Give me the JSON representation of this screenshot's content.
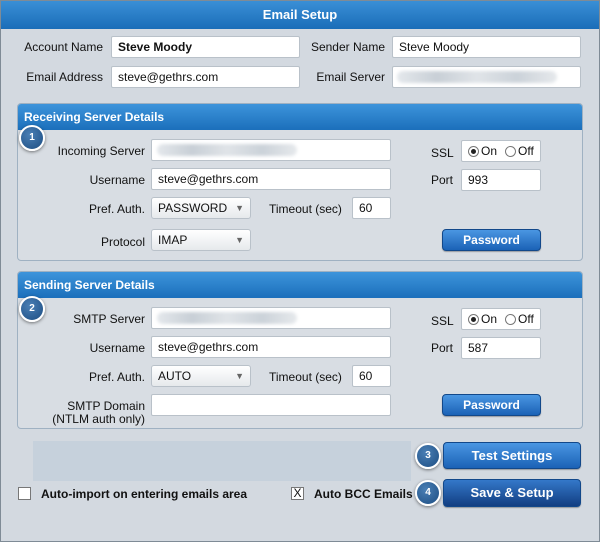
{
  "window": {
    "title": "Email Setup"
  },
  "account": {
    "account_name_label": "Account Name",
    "account_name_value": "Steve Moody",
    "sender_name_label": "Sender Name",
    "sender_name_value": "Steve Moody",
    "email_address_label": "Email Address",
    "email_address_value": "steve@gethrs.com",
    "email_server_label": "Email Server",
    "email_server_value": ""
  },
  "receiving": {
    "header": "Receiving Server Details",
    "badge": "1",
    "incoming_server_label": "Incoming Server",
    "incoming_server_value": "",
    "username_label": "Username",
    "username_value": "steve@gethrs.com",
    "pref_auth_label": "Pref. Auth.",
    "pref_auth_value": "PASSWORD",
    "timeout_label": "Timeout (sec)",
    "timeout_value": "60",
    "protocol_label": "Protocol",
    "protocol_value": "IMAP",
    "ssl_label": "SSL",
    "ssl_on_label": "On",
    "ssl_off_label": "Off",
    "ssl_selected": "On",
    "port_label": "Port",
    "port_value": "993",
    "password_button": "Password"
  },
  "sending": {
    "header": "Sending Server Details",
    "badge": "2",
    "smtp_server_label": "SMTP Server",
    "smtp_server_value": "",
    "username_label": "Username",
    "username_value": "steve@gethrs.com",
    "pref_auth_label": "Pref. Auth.",
    "pref_auth_value": "AUTO",
    "timeout_label": "Timeout (sec)",
    "timeout_value": "60",
    "smtp_domain_label": "SMTP Domain",
    "smtp_domain_sub_label": "(NTLM auth only)",
    "smtp_domain_value": "",
    "ssl_label": "SSL",
    "ssl_on_label": "On",
    "ssl_off_label": "Off",
    "ssl_selected": "On",
    "port_label": "Port",
    "port_value": "587",
    "password_button": "Password"
  },
  "footer": {
    "test_badge": "3",
    "test_button": "Test Settings",
    "save_badge": "4",
    "save_button": "Save & Setup",
    "auto_import_label": "Auto-import on entering emails area",
    "auto_import_checked": false,
    "auto_bcc_label": "Auto BCC Emails",
    "auto_bcc_checked": true,
    "auto_bcc_mark": "X"
  },
  "colors": {
    "accent": "#1b6fbb",
    "window_bg": "#d3d9e0"
  },
  "icons": {
    "dropdown": "chevron-down-icon",
    "badge": "step-number-badge"
  }
}
